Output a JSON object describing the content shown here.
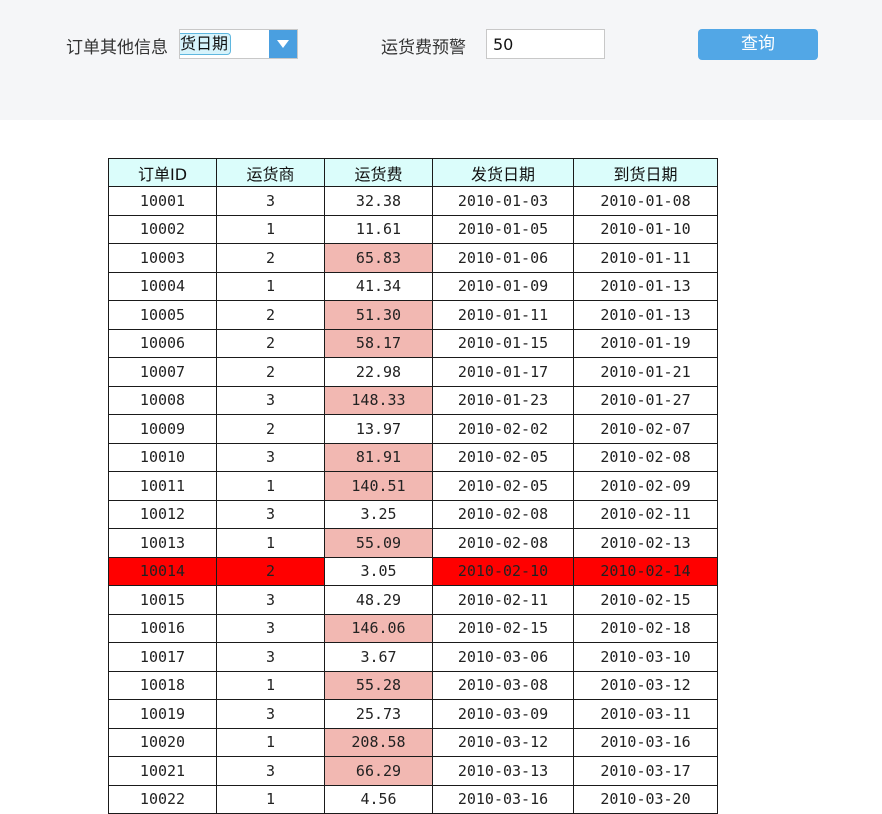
{
  "filter": {
    "other_info_label": "订单其他信息",
    "other_info_value": "货日期",
    "freight_warning_label": "运货费预警",
    "freight_warning_value": "50",
    "query_button": "查询",
    "dropdown_icon": "chevron-down-icon"
  },
  "colors": {
    "header_bg": "#dbfdfb",
    "warning_cell": "#f2b8b2",
    "alert_row": "#ff0000",
    "button": "#52a7e6"
  },
  "table": {
    "columns": [
      "订单ID",
      "运货商",
      "运货费",
      "发货日期",
      "到货日期"
    ],
    "rows": [
      {
        "id": "10001",
        "carrier": "3",
        "freight": "32.38",
        "ship": "2010-01-03",
        "arrive": "2010-01-08",
        "warn": false,
        "alert": false
      },
      {
        "id": "10002",
        "carrier": "1",
        "freight": "11.61",
        "ship": "2010-01-05",
        "arrive": "2010-01-10",
        "warn": false,
        "alert": false
      },
      {
        "id": "10003",
        "carrier": "2",
        "freight": "65.83",
        "ship": "2010-01-06",
        "arrive": "2010-01-11",
        "warn": true,
        "alert": false
      },
      {
        "id": "10004",
        "carrier": "1",
        "freight": "41.34",
        "ship": "2010-01-09",
        "arrive": "2010-01-13",
        "warn": false,
        "alert": false
      },
      {
        "id": "10005",
        "carrier": "2",
        "freight": "51.30",
        "ship": "2010-01-11",
        "arrive": "2010-01-13",
        "warn": true,
        "alert": false
      },
      {
        "id": "10006",
        "carrier": "2",
        "freight": "58.17",
        "ship": "2010-01-15",
        "arrive": "2010-01-19",
        "warn": true,
        "alert": false
      },
      {
        "id": "10007",
        "carrier": "2",
        "freight": "22.98",
        "ship": "2010-01-17",
        "arrive": "2010-01-21",
        "warn": false,
        "alert": false
      },
      {
        "id": "10008",
        "carrier": "3",
        "freight": "148.33",
        "ship": "2010-01-23",
        "arrive": "2010-01-27",
        "warn": true,
        "alert": false
      },
      {
        "id": "10009",
        "carrier": "2",
        "freight": "13.97",
        "ship": "2010-02-02",
        "arrive": "2010-02-07",
        "warn": false,
        "alert": false
      },
      {
        "id": "10010",
        "carrier": "3",
        "freight": "81.91",
        "ship": "2010-02-05",
        "arrive": "2010-02-08",
        "warn": true,
        "alert": false
      },
      {
        "id": "10011",
        "carrier": "1",
        "freight": "140.51",
        "ship": "2010-02-05",
        "arrive": "2010-02-09",
        "warn": true,
        "alert": false
      },
      {
        "id": "10012",
        "carrier": "3",
        "freight": "3.25",
        "ship": "2010-02-08",
        "arrive": "2010-02-11",
        "warn": false,
        "alert": false
      },
      {
        "id": "10013",
        "carrier": "1",
        "freight": "55.09",
        "ship": "2010-02-08",
        "arrive": "2010-02-13",
        "warn": true,
        "alert": false
      },
      {
        "id": "10014",
        "carrier": "2",
        "freight": "3.05",
        "ship": "2010-02-10",
        "arrive": "2010-02-14",
        "warn": false,
        "alert": true
      },
      {
        "id": "10015",
        "carrier": "3",
        "freight": "48.29",
        "ship": "2010-02-11",
        "arrive": "2010-02-15",
        "warn": false,
        "alert": false
      },
      {
        "id": "10016",
        "carrier": "3",
        "freight": "146.06",
        "ship": "2010-02-15",
        "arrive": "2010-02-18",
        "warn": true,
        "alert": false
      },
      {
        "id": "10017",
        "carrier": "3",
        "freight": "3.67",
        "ship": "2010-03-06",
        "arrive": "2010-03-10",
        "warn": false,
        "alert": false
      },
      {
        "id": "10018",
        "carrier": "1",
        "freight": "55.28",
        "ship": "2010-03-08",
        "arrive": "2010-03-12",
        "warn": true,
        "alert": false
      },
      {
        "id": "10019",
        "carrier": "3",
        "freight": "25.73",
        "ship": "2010-03-09",
        "arrive": "2010-03-11",
        "warn": false,
        "alert": false
      },
      {
        "id": "10020",
        "carrier": "1",
        "freight": "208.58",
        "ship": "2010-03-12",
        "arrive": "2010-03-16",
        "warn": true,
        "alert": false
      },
      {
        "id": "10021",
        "carrier": "3",
        "freight": "66.29",
        "ship": "2010-03-13",
        "arrive": "2010-03-17",
        "warn": true,
        "alert": false
      },
      {
        "id": "10022",
        "carrier": "1",
        "freight": "4.56",
        "ship": "2010-03-16",
        "arrive": "2010-03-20",
        "warn": false,
        "alert": false
      }
    ]
  }
}
